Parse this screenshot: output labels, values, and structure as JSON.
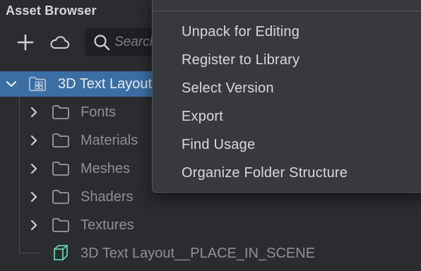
{
  "panel": {
    "title": "Asset Browser"
  },
  "toolbar": {
    "add_icon": "plus-icon",
    "cloud_icon": "cloud-icon",
    "search_icon": "search-icon",
    "search_placeholder": "Search"
  },
  "tree": {
    "root": {
      "label": "3D Text Layout",
      "icon": "package-folder-icon",
      "expanded": true,
      "selected": true
    },
    "children": [
      {
        "label": "Fonts",
        "icon": "folder-icon",
        "expandable": true
      },
      {
        "label": "Materials",
        "icon": "folder-icon",
        "expandable": true
      },
      {
        "label": "Meshes",
        "icon": "folder-icon",
        "expandable": true
      },
      {
        "label": "Shaders",
        "icon": "folder-icon",
        "expandable": true
      },
      {
        "label": "Textures",
        "icon": "folder-icon",
        "expandable": true
      },
      {
        "label": "3D Text Layout__PLACE_IN_SCENE",
        "icon": "prefab-cube-icon",
        "expandable": false
      }
    ]
  },
  "context_menu": {
    "items": [
      {
        "label": "Unpack for Editing"
      },
      {
        "label": "Register to Library"
      },
      {
        "label": "Select Version"
      },
      {
        "label": "Export"
      },
      {
        "label": "Find Usage"
      },
      {
        "label": "Organize Folder Structure"
      }
    ]
  },
  "colors": {
    "background": "#2b2c2f",
    "selection": "#3b6fa3",
    "menu_background": "#38393c",
    "prefab_accent": "#5fd3a8"
  }
}
